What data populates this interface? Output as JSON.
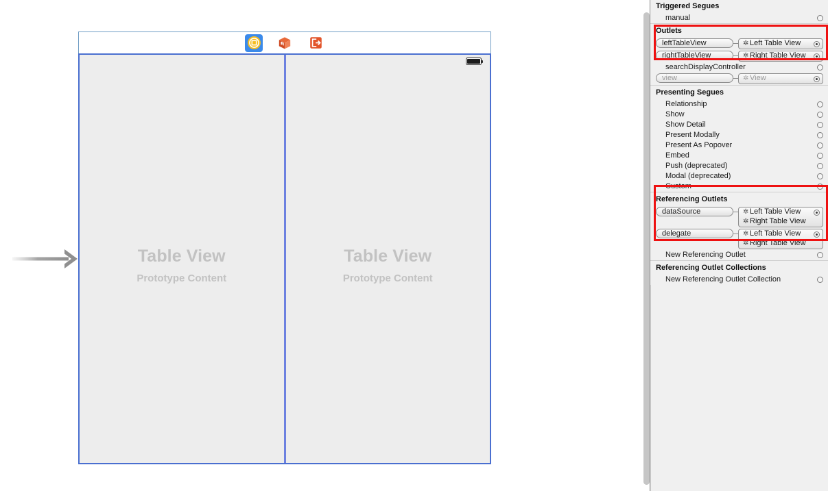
{
  "canvas": {
    "entry_arrow": "storyboard-entry-point-arrow",
    "scene_dock": {
      "icons": [
        {
          "name": "view-controller-icon",
          "selected": true
        },
        {
          "name": "first-responder-icon",
          "selected": false
        },
        {
          "name": "exit-icon",
          "selected": false
        }
      ]
    },
    "status_bar": {
      "battery_icon": "battery-icon"
    },
    "panes": [
      {
        "title": "Table View",
        "subtitle": "Prototype Content",
        "name": "left-table-view"
      },
      {
        "title": "Table View",
        "subtitle": "Prototype Content",
        "name": "right-table-view"
      }
    ]
  },
  "inspector": {
    "sections": [
      {
        "id": "triggered-segues",
        "title": "Triggered Segues",
        "type": "simple",
        "rows": [
          {
            "label": "manual",
            "filled": false
          }
        ]
      },
      {
        "id": "outlets",
        "title": "Outlets",
        "type": "connections",
        "highlighted": true,
        "rows": [
          {
            "kind": "connection",
            "outlet": "leftTableView",
            "targets": [
              {
                "label": "Left Table View",
                "dim": false
              }
            ],
            "filled": true
          },
          {
            "kind": "connection",
            "outlet": "rightTableView",
            "targets": [
              {
                "label": "Right Table View",
                "dim": false
              }
            ],
            "filled": true
          },
          {
            "kind": "simple",
            "label": "searchDisplayController",
            "filled": false
          },
          {
            "kind": "connection",
            "outlet": "view",
            "dim": true,
            "targets": [
              {
                "label": "View",
                "dim": true
              }
            ],
            "filled": true
          }
        ]
      },
      {
        "id": "presenting-segues",
        "title": "Presenting Segues",
        "type": "simple",
        "rows": [
          {
            "label": "Relationship",
            "filled": false
          },
          {
            "label": "Show",
            "filled": false
          },
          {
            "label": "Show Detail",
            "filled": false
          },
          {
            "label": "Present Modally",
            "filled": false
          },
          {
            "label": "Present As Popover",
            "filled": false
          },
          {
            "label": "Embed",
            "filled": false
          },
          {
            "label": "Push (deprecated)",
            "filled": false
          },
          {
            "label": "Modal (deprecated)",
            "filled": false
          },
          {
            "label": "Custom",
            "filled": false
          }
        ]
      },
      {
        "id": "referencing-outlets",
        "title": "Referencing Outlets",
        "type": "connections",
        "highlighted": true,
        "rows": [
          {
            "kind": "connection",
            "outlet": "dataSource",
            "targets": [
              {
                "label": "Left Table View",
                "dim": false
              },
              {
                "label": "Right Table View",
                "dim": false
              }
            ],
            "filled": true
          },
          {
            "kind": "connection",
            "outlet": "delegate",
            "targets": [
              {
                "label": "Left Table View",
                "dim": false
              },
              {
                "label": "Right Table View",
                "dim": false
              }
            ],
            "filled": true
          },
          {
            "kind": "simple",
            "label": "New Referencing Outlet",
            "filled": false
          }
        ]
      },
      {
        "id": "referencing-outlet-collections",
        "title": "Referencing Outlet Collections",
        "type": "simple",
        "rows": [
          {
            "label": "New Referencing Outlet Collection",
            "filled": false
          }
        ]
      }
    ]
  },
  "colors": {
    "highlight": "#ee1111",
    "selection_blue": "#3b8aea",
    "vc_border": "#4a6fd0",
    "panel_bg": "#f0f0f0",
    "canvas_content": "#ededed",
    "placeholder_text": "#c2c2c2"
  }
}
